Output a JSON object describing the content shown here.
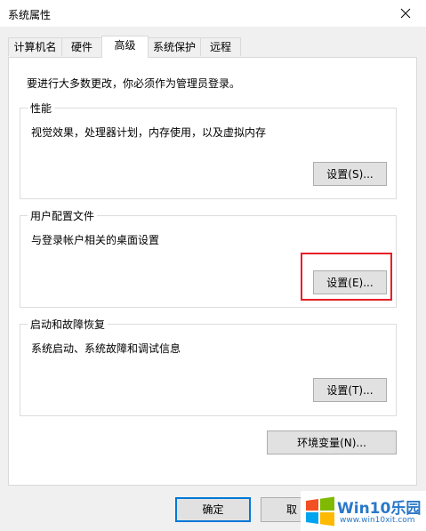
{
  "window": {
    "title": "系统属性"
  },
  "tabs": [
    {
      "label": "计算机名",
      "active": false
    },
    {
      "label": "硬件",
      "active": false
    },
    {
      "label": "高级",
      "active": true
    },
    {
      "label": "系统保护",
      "active": false
    },
    {
      "label": "远程",
      "active": false
    }
  ],
  "advanced": {
    "intro": "要进行大多数更改，你必须作为管理员登录。",
    "performance": {
      "title": "性能",
      "description": "视觉效果，处理器计划，内存使用，以及虚拟内存",
      "button": "设置(S)..."
    },
    "user_profiles": {
      "title": "用户配置文件",
      "description": "与登录帐户相关的桌面设置",
      "button": "设置(E)..."
    },
    "startup_recovery": {
      "title": "启动和故障恢复",
      "description": "系统启动、系统故障和调试信息",
      "button": "设置(T)..."
    },
    "env_button": "环境变量(N)..."
  },
  "footer": {
    "ok": "确定",
    "cancel": "取"
  },
  "watermark": {
    "brand": "Win10乐园",
    "url": "www.win10xit.com"
  },
  "colors": {
    "highlight": "#e81f25",
    "accent": "#0078d7"
  }
}
